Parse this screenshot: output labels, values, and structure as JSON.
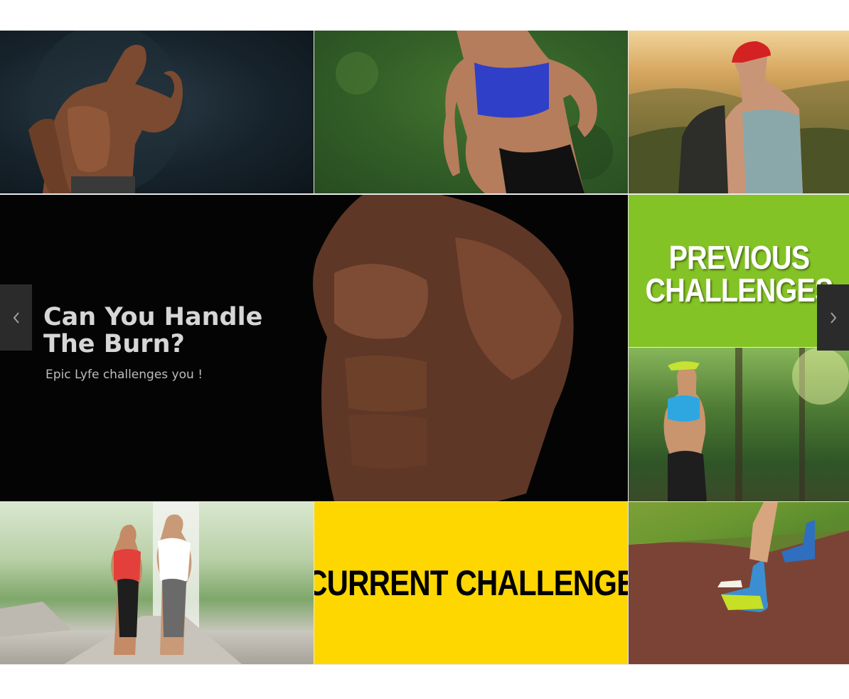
{
  "hero": {
    "title_line1": "Can You Handle",
    "title_line2": "The Burn?",
    "subtitle": "Epic Lyfe challenges you !"
  },
  "tiles": {
    "previous": {
      "line1": "PREVIOUS",
      "line2": "CHALLENGES",
      "bg": "#84c325"
    },
    "current": {
      "label": "CURRENT CHALLENGE",
      "bg": "#fed600"
    }
  },
  "icons": {
    "left": "chevron-left-icon",
    "right": "chevron-right-icon"
  }
}
